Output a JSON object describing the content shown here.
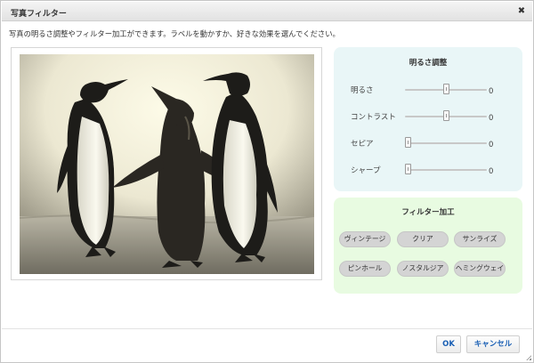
{
  "dialog": {
    "title": "写真フィルター",
    "close_icon": "close-icon",
    "instruction": "写真の明るさ調整やフィルター加工ができます。ラベルを動かすか、好きな効果を選んでください。"
  },
  "photo": {
    "subject": "penguins"
  },
  "brightness_panel": {
    "title": "明るさ調整",
    "rows": [
      {
        "label": "明るさ",
        "value": "0",
        "level": 0.5
      },
      {
        "label": "コントラスト",
        "value": "0",
        "level": 0.5
      },
      {
        "label": "セピア",
        "value": "0",
        "level": 0.0
      },
      {
        "label": "シャープ",
        "value": "0",
        "level": 0.0
      }
    ]
  },
  "filter_panel": {
    "title": "フィルター加工",
    "buttons": [
      "ヴィンテージ",
      "クリア",
      "サンライズ",
      "ピンホール",
      "ノスタルジア",
      "ヘミングウェイ"
    ]
  },
  "footer": {
    "ok": "OK",
    "cancel": "キャンセル"
  },
  "colors": {
    "brightness_panel": "#e9f6f7",
    "filter_panel": "#e8fbe1",
    "button_text": "#1a5fb4"
  }
}
